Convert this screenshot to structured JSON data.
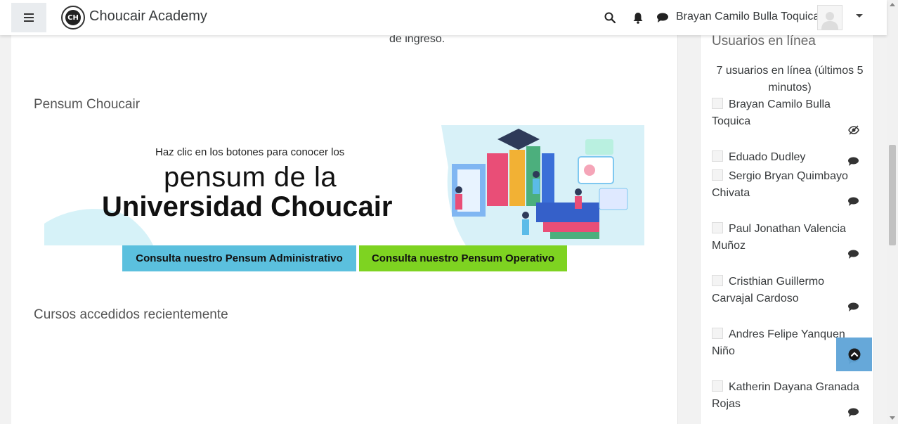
{
  "navbar": {
    "site_name": "Choucair Academy",
    "user_name": "Brayan Camilo Bulla Toquica"
  },
  "main": {
    "fragment_text": "de ingreso.",
    "pensum_title": "Pensum Choucair",
    "banner": {
      "subtitle": "Haz clic en los botones para conocer los",
      "line1": "pensum de la",
      "line2": "Universidad Choucair"
    },
    "buttons": {
      "admin_label": "Consulta nuestro Pensum Administrativo",
      "operative_label": "Consulta nuestro Pensum Operativo"
    },
    "recent_title": "Cursos accedidos recientemente"
  },
  "sidebar": {
    "title": "Usuarios en línea",
    "summary": "7 usuarios en línea (últimos 5 minutos)",
    "users": [
      {
        "name": "Brayan Camilo Bulla Toquica",
        "icon": "hide-eye-icon"
      },
      {
        "name": "Eduado Dudley",
        "icon": "message-icon"
      },
      {
        "name": "Sergio Bryan Quimbayo Chivata",
        "icon": "message-icon"
      },
      {
        "name": "Paul Jonathan Valencia Muñoz",
        "icon": "message-icon"
      },
      {
        "name": "Cristhian Guillermo Carvajal Cardoso",
        "icon": "message-icon"
      },
      {
        "name": "Andres Felipe Yanquen Niño",
        "icon": "message-icon"
      },
      {
        "name": "Katherin Dayana Granada Rojas",
        "icon": "message-icon"
      }
    ]
  },
  "colors": {
    "admin_button": "#5bc0de",
    "operative_button": "#7ed321",
    "back_to_top": "#5ea4d8"
  }
}
